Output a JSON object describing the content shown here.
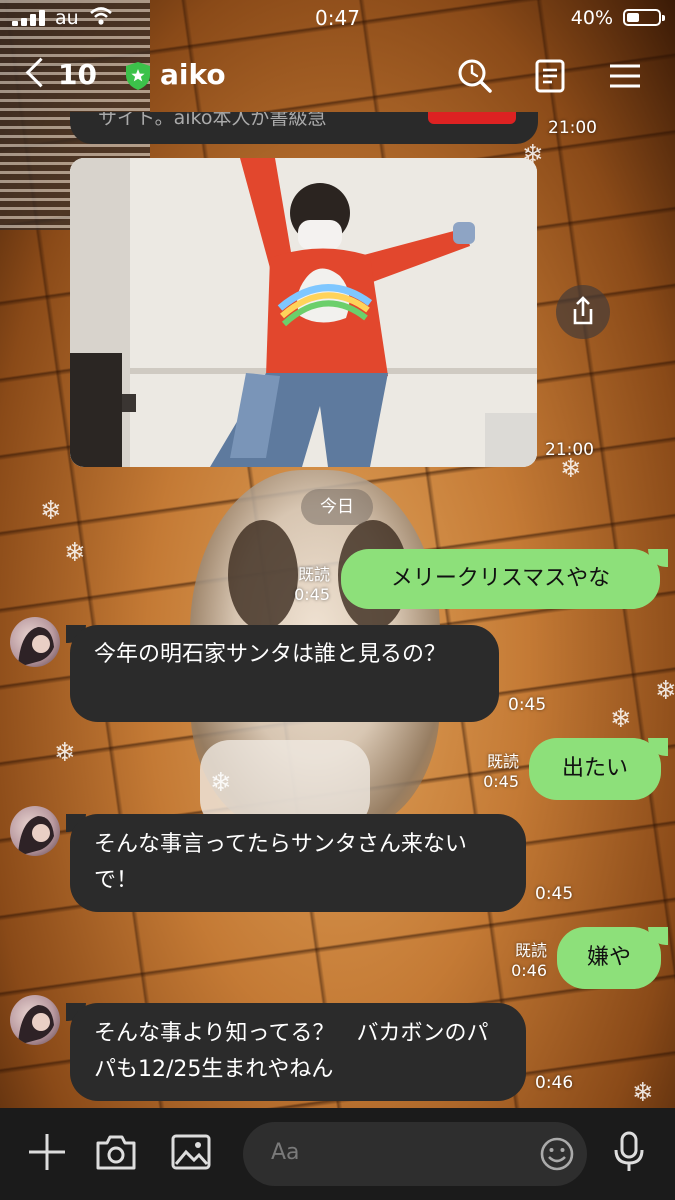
{
  "status_bar": {
    "carrier": "au",
    "time": "0:47",
    "battery_percent": "40%",
    "battery_level": 0.4
  },
  "header": {
    "back_count": "10",
    "chat_name": "aiko",
    "icons": [
      "search-icon",
      "notes-icon",
      "menu-icon"
    ]
  },
  "messages": {
    "prev_partial_text": "サイト。aiko本人が書級急",
    "prev_time": "21:00",
    "photo_time": "21:00",
    "date_separator": "今日",
    "m1": {
      "text": "メリークリスマスやな",
      "read": "既読",
      "time": "0:45"
    },
    "m2": {
      "text": "今年の明石家サンタは誰と見るの？",
      "time": "0:45"
    },
    "m3": {
      "text": "出たい",
      "read": "既読",
      "time": "0:45"
    },
    "m4": {
      "text": "そんな事言ってたらサンタさん来ないで！",
      "time": "0:45"
    },
    "m5": {
      "text": "嫌や",
      "read": "既読",
      "time": "0:46"
    },
    "m6": {
      "text": "そんな事より知ってる？　バカボンのパパも12/25生まれやねん",
      "time": "0:46"
    }
  },
  "composer": {
    "placeholder": "Aa",
    "icons": [
      "plus-icon",
      "camera-icon",
      "image-icon",
      "emoji-icon",
      "microphone-icon"
    ]
  },
  "colors": {
    "sent_bubble": "#8de07a",
    "received_bubble": "#2b2b2b",
    "bottom_bar": "#1b1b1b",
    "shield_green": "#3cc24a"
  }
}
